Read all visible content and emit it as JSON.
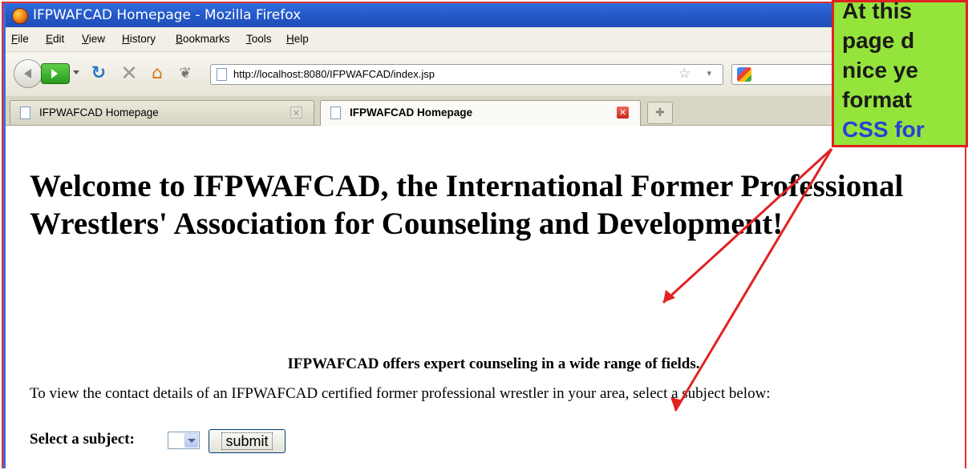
{
  "window": {
    "title": "IFPWAFCAD Homepage - Mozilla Firefox"
  },
  "menu": {
    "items": [
      "File",
      "Edit",
      "View",
      "History",
      "Bookmarks",
      "Tools",
      "Help"
    ]
  },
  "toolbar": {
    "url": "http://localhost:8080/IFPWAFCAD/index.jsp",
    "icons": [
      "back-icon",
      "forward-icon",
      "reload-icon",
      "stop-icon",
      "home-icon",
      "bookmark-icon",
      "star-icon",
      "google-icon"
    ]
  },
  "tabs": [
    {
      "label": "IFPWAFCAD Homepage",
      "active": false
    },
    {
      "label": "IFPWAFCAD Homepage",
      "active": true
    }
  ],
  "page": {
    "heading": "Welcome to IFPWAFCAD, the International Former Professional Wrestlers' Association for Counseling and Development!",
    "offers": "IFPWAFCAD offers expert counseling in a wide range of fields.",
    "instructions": "To view the contact details of an IFPWAFCAD certified former professional wrestler in your area, select a subject below:",
    "select_label": "Select a subject:",
    "submit_label": "submit"
  },
  "callout": {
    "lines": [
      "At this",
      "page d",
      "nice ye",
      "format",
      "CSS for"
    ],
    "colors": {
      "background": "#95e43b",
      "border": "#e02222",
      "link": "#2a3fd8"
    }
  }
}
